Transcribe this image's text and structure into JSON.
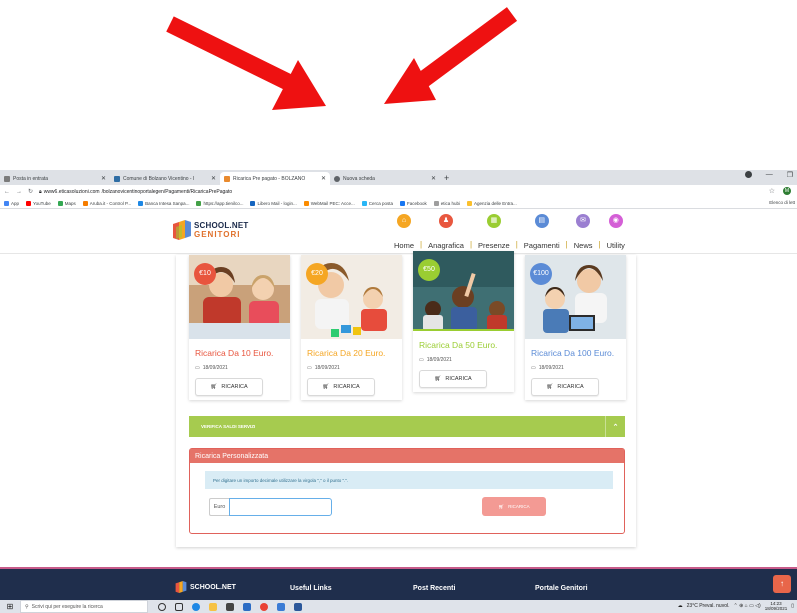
{
  "browser": {
    "tabs": [
      {
        "title": "Posta in entrata",
        "color": "#7b7b7b"
      },
      {
        "title": "Comune di Bolzano Vicentino - I",
        "color": "#2e6da4"
      },
      {
        "title": "Ricarica Pre pagato - BOLZANO",
        "color": "#e98a2e",
        "active": true
      },
      {
        "title": "Nuova scheda",
        "color": "#5f6368"
      }
    ],
    "new_tab": "+",
    "url_host": "www6.eticasoluzioni.com",
    "url_path": "/bolzanovicentinoportalegen/Pagamenti/RicaricaPrePagato",
    "bookmarks": [
      {
        "label": "App",
        "color": "#4285f4"
      },
      {
        "label": "YouTube",
        "color": "#ff0000"
      },
      {
        "label": "Maps",
        "color": "#34a853"
      },
      {
        "label": "Aruba.it - Control P...",
        "color": "#f57c00"
      },
      {
        "label": "Banca Intesa Sanpa...",
        "color": "#1e88e5"
      },
      {
        "label": "https://app.tienilco...",
        "color": "#43a047"
      },
      {
        "label": "Libero Mail - login...",
        "color": "#1565c0"
      },
      {
        "label": "WebMail PEC: Acce...",
        "color": "#fb8c00"
      },
      {
        "label": "Cerca posta",
        "color": "#29b6f6"
      },
      {
        "label": "Facebook",
        "color": "#1877f2"
      },
      {
        "label": "etica hubi",
        "color": "#9e9e9e"
      },
      {
        "label": "Agenzia delle Entra...",
        "color": "#fbc02d"
      }
    ],
    "bookmarks_other": "Elenco di lett",
    "avatar_letter": "M"
  },
  "site": {
    "logo_line1": "SCHOOL.NET",
    "logo_line2": "GENITORI",
    "nav": [
      {
        "label": "Home",
        "color": "#f5a623",
        "glyph": "⌂"
      },
      {
        "label": "Anagrafica",
        "color": "#e8573f",
        "glyph": "♟"
      },
      {
        "label": "Presenze",
        "color": "#9acd32",
        "glyph": "▦"
      },
      {
        "label": "Pagamenti",
        "color": "#5b8bd6",
        "glyph": "▤"
      },
      {
        "label": "News",
        "color": "#9b7fd1",
        "glyph": "✉"
      },
      {
        "label": "Utility",
        "color": "#d45fd6",
        "glyph": "◉"
      }
    ]
  },
  "cards": [
    {
      "badge": "€10",
      "title": "Ricarica Da 10 Euro.",
      "title_color": "#e8553e",
      "badge_color": "#e8553e",
      "date": "18/09/2021",
      "button": "RICARICA"
    },
    {
      "badge": "€20",
      "title": "Ricarica Da 20 Euro.",
      "title_color": "#f5a623",
      "badge_color": "#f5a623",
      "date": "18/09/2021",
      "button": "RICARICA"
    },
    {
      "badge": "€50",
      "title": "Ricarica Da 50 Euro.",
      "title_color": "#9acd32",
      "badge_color": "#9acd32",
      "date": "18/09/2021",
      "button": "RICARICA"
    },
    {
      "badge": "€100",
      "title": "Ricarica Da 100 Euro.",
      "title_color": "#5b8bd6",
      "badge_color": "#5b8bd6",
      "date": "18/09/2021",
      "button": "RICARICA"
    }
  ],
  "verifica": {
    "label": "VERIFICA SALDI SERVIZI",
    "toggle": "⌃"
  },
  "ricarica_personalizzata": {
    "header": "Ricarica Personalizzata",
    "info": "Per digitare un importo decimale utilizzare la virgola \",\" o il punto \".\".",
    "field_label": "Euro",
    "field_value": "",
    "button": "RICARICA"
  },
  "footer": {
    "logo": "SCHOOL.NET",
    "columns": [
      "Useful Links",
      "Post Recenti",
      "Portale Genitori"
    ],
    "scroll_top": "↑"
  },
  "taskbar": {
    "search_placeholder": "Scrivi qui per eseguire la ricerca",
    "weather": "23°C Preval. nuvol.",
    "time": "14:23",
    "date": "18/09/2021"
  }
}
